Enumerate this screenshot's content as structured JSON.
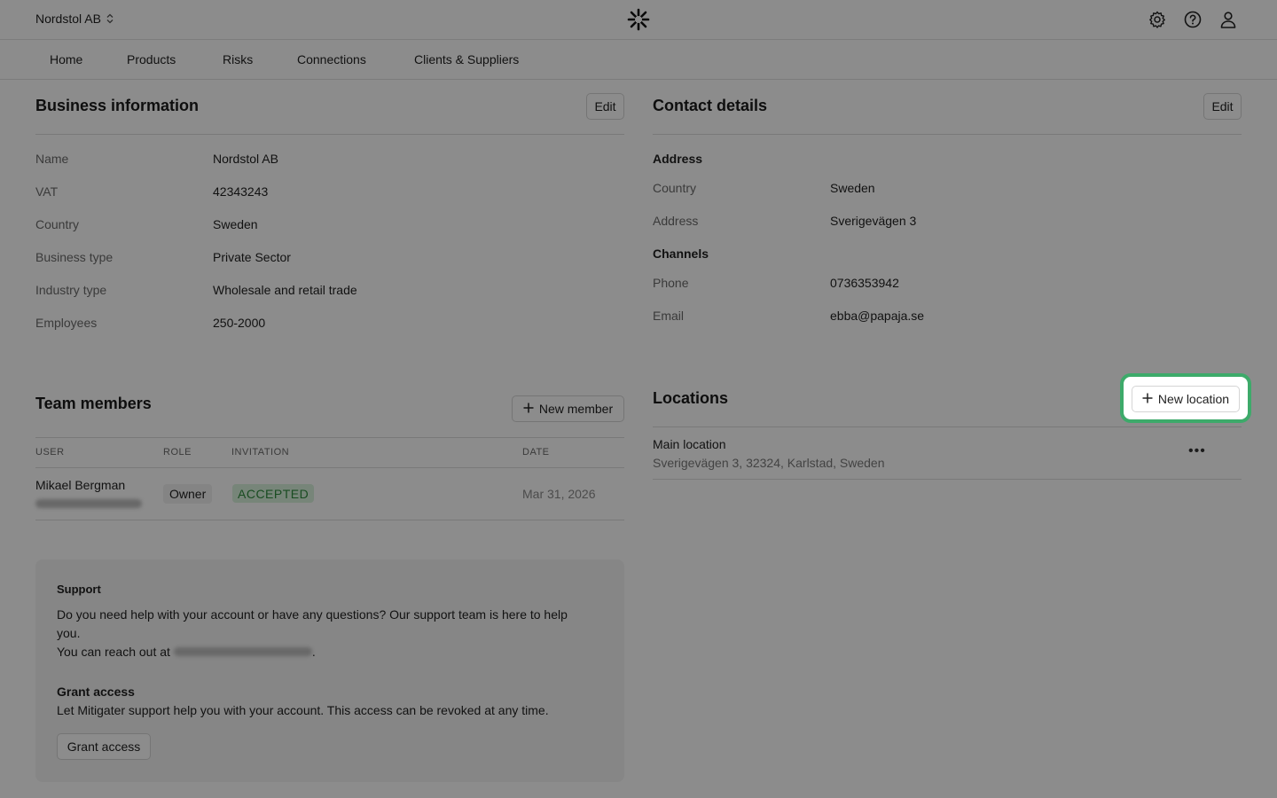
{
  "header": {
    "org_name": "Nordstol AB",
    "nav": [
      "Home",
      "Products",
      "Risks",
      "Connections",
      "Clients & Suppliers"
    ],
    "icons": [
      "settings-icon",
      "help-icon",
      "user-icon"
    ]
  },
  "business": {
    "title": "Business information",
    "edit_label": "Edit",
    "rows": [
      {
        "label": "Name",
        "value": "Nordstol AB"
      },
      {
        "label": "VAT",
        "value": "42343243"
      },
      {
        "label": "Country",
        "value": "Sweden"
      },
      {
        "label": "Business type",
        "value": "Private Sector"
      },
      {
        "label": "Industry type",
        "value": "Wholesale and retail trade"
      },
      {
        "label": "Employees",
        "value": "250-2000"
      }
    ]
  },
  "contact": {
    "title": "Contact details",
    "edit_label": "Edit",
    "address_heading": "Address",
    "address_rows": [
      {
        "label": "Country",
        "value": "Sweden"
      },
      {
        "label": "Address",
        "value": "Sverigevägen 3"
      }
    ],
    "channels_heading": "Channels",
    "channel_rows": [
      {
        "label": "Phone",
        "value": "0736353942"
      },
      {
        "label": "Email",
        "value": "ebba@papaja.se"
      }
    ]
  },
  "team": {
    "title": "Team members",
    "new_member_label": "New member",
    "columns": [
      "USER",
      "ROLE",
      "INVITATION",
      "DATE"
    ],
    "members": [
      {
        "name": "Mikael Bergman",
        "role": "Owner",
        "invitation": "ACCEPTED",
        "date": "Mar 31, 2026"
      }
    ]
  },
  "locations": {
    "title": "Locations",
    "new_location_label": "New location",
    "items": [
      {
        "name": "Main location",
        "address": "Sverigevägen 3, 32324, Karlstad, Sweden"
      }
    ]
  },
  "support": {
    "title": "Support",
    "line1": "Do you need help with your account or have any questions? Our support team is here to help",
    "line2": "you.",
    "line3_prefix": "You can reach out at",
    "line3_suffix": ".",
    "grant_title": "Grant access",
    "grant_text": "Let Mitigater support help you with your account. This access can be revoked at any time.",
    "grant_button": "Grant access"
  },
  "colors": {
    "accent_highlight": "#3daa6a",
    "status_accepted_bg": "#d9f2dd",
    "status_accepted_text": "#2f8a3d"
  }
}
